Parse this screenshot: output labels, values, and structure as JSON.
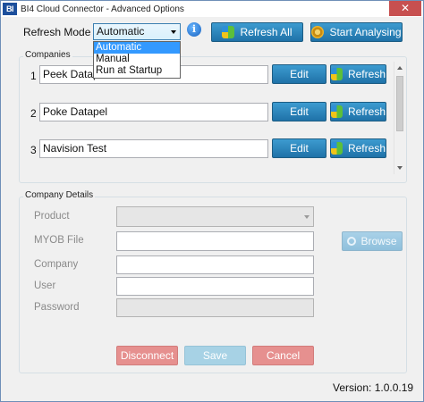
{
  "window": {
    "app_badge": "BI",
    "title": "BI4 Cloud Connector - Advanced Options",
    "close_glyph": "✕"
  },
  "toolbar": {
    "refresh_mode_label": "Refresh Mode",
    "refresh_mode_value": "Automatic",
    "refresh_mode_options": [
      "Automatic",
      "Manual",
      "Run at Startup"
    ],
    "info_glyph": "i",
    "refresh_all_label": "Refresh All",
    "start_analysing_label": "Start Analysing"
  },
  "companies": {
    "group_label": "Companies",
    "rows": [
      {
        "num": "1",
        "name": "Peek Datapel",
        "edit_label": "Edit",
        "refresh_label": "Refresh"
      },
      {
        "num": "2",
        "name": "Poke Datapel",
        "edit_label": "Edit",
        "refresh_label": "Refresh"
      },
      {
        "num": "3",
        "name": "Navision Test",
        "edit_label": "Edit",
        "refresh_label": "Refresh"
      }
    ]
  },
  "details": {
    "group_label": "Company Details",
    "product_label": "Product",
    "myob_file_label": "MYOB File",
    "company_label": "Company",
    "user_label": "User",
    "password_label": "Password",
    "browse_label": "Browse"
  },
  "actions": {
    "disconnect_label": "Disconnect",
    "save_label": "Save",
    "cancel_label": "Cancel"
  },
  "footer": {
    "version": "Version: 1.0.0.19"
  },
  "colors": {
    "accent_blue": "#1f72a8",
    "danger_pink": "#e6908f",
    "selected_option": "#3399ff"
  }
}
